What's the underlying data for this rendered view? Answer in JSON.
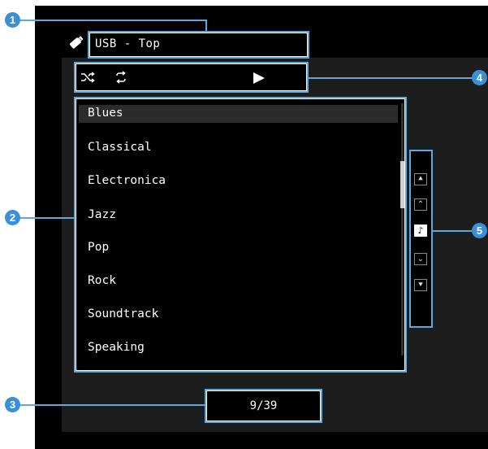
{
  "source": {
    "icon": "usb-memory-icon",
    "path": "USB - Top"
  },
  "controls": {
    "shuffle_icon": "shuffle-icon",
    "repeat_icon": "repeat-icon",
    "play_icon": "play-icon"
  },
  "list": {
    "items": [
      "Blues",
      "Classical",
      "Electronica",
      "Jazz",
      "Pop",
      "Rock",
      "Soundtrack",
      "Speaking"
    ],
    "selected_index": 0
  },
  "navigation": {
    "buttons": [
      "page-up-icon",
      "up-icon",
      "now-playing-icon",
      "down-icon",
      "page-down-icon"
    ]
  },
  "page_indicator": "9/39",
  "callouts": [
    "1",
    "2",
    "3",
    "4",
    "5"
  ],
  "colors": {
    "highlight": "#5fa8dd",
    "badge": "#3b8fd6",
    "screen": "#000000"
  }
}
